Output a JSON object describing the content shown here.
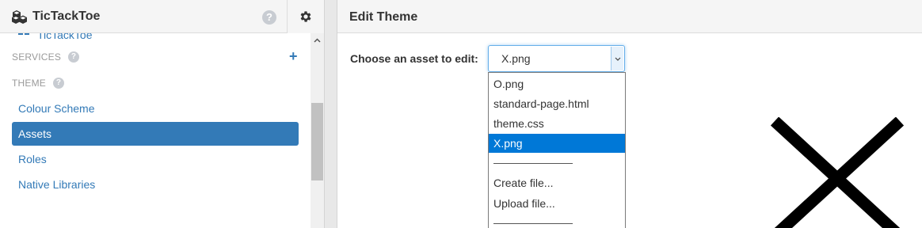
{
  "app": {
    "title": "TicTackToe"
  },
  "sidebar": {
    "cut_item_label": "TicTackToe",
    "services_label": "SERVICES",
    "theme_label": "THEME",
    "items": [
      {
        "label": "Colour Scheme",
        "active": false
      },
      {
        "label": "Assets",
        "active": true
      },
      {
        "label": "Roles",
        "active": false
      },
      {
        "label": "Native Libraries",
        "active": false
      }
    ]
  },
  "main": {
    "title": "Edit Theme",
    "choose_label": "Choose an asset to edit:",
    "selected_value": "X.png",
    "options": [
      {
        "label": "O.png"
      },
      {
        "label": "standard-page.html"
      },
      {
        "label": "theme.css"
      },
      {
        "label": "X.png",
        "selected": true
      },
      {
        "label": "Create file..."
      },
      {
        "label": "Upload file..."
      }
    ],
    "separator": "—————————"
  },
  "colors": {
    "accent": "#337ab7",
    "dropdown_highlight": "#0078d7"
  }
}
